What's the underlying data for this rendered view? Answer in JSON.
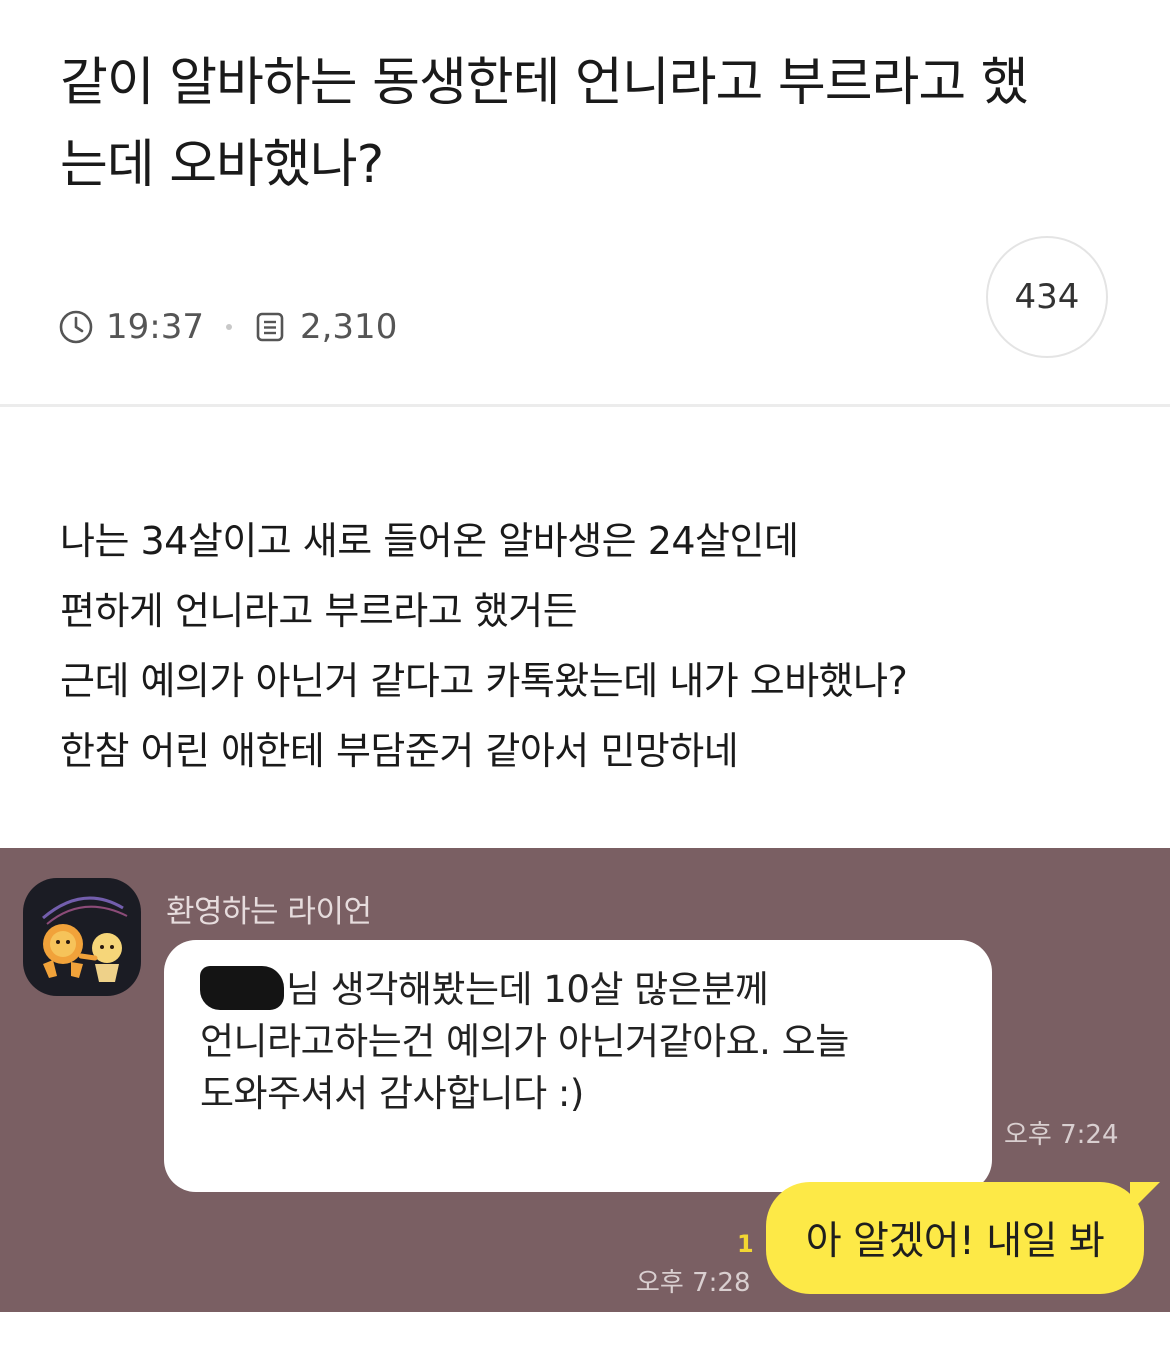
{
  "post": {
    "title_line1": "같이 알바하는 동생한테 언니라고 부르라고 했",
    "title_line2": "는데 오바했나?",
    "time": "19:37",
    "views": "2,310",
    "comment_count": "434",
    "body": [
      "나는 34살이고 새로 들어온 알바생은 24살인데",
      "편하게 언니라고 부르라고 했거든",
      "근데 예의가 아닌거 같다고 카톡왔는데 내가 오바했나?",
      "한참 어린 애한테 부담준거 같아서 민망하네"
    ]
  },
  "chat": {
    "background_color": "#7a5f63",
    "sender_name": "환영하는 라이언",
    "incoming": {
      "line1": "님 생각해봤는데 10살 많은분께",
      "line2": "언니라고하는건 예의가 아닌거같아요. 오늘",
      "line3": "도와주셔서 감사합니다 :)",
      "time": "오후 7:24"
    },
    "outgoing": {
      "text": "아 알겠어! 내일 봐",
      "unread": "1",
      "time": "오후 7:28",
      "bubble_color": "#fde947"
    }
  }
}
